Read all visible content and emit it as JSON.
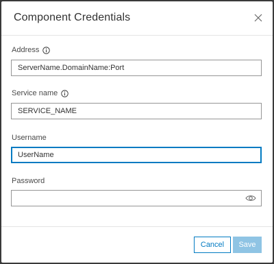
{
  "dialog": {
    "title": "Component Credentials"
  },
  "fields": {
    "address": {
      "label": "Address",
      "value": "ServerName.DomainName:Port"
    },
    "service_name": {
      "label": "Service name",
      "value": "SERVICE_NAME"
    },
    "username": {
      "label": "Username",
      "value": "UserName"
    },
    "password": {
      "label": "Password",
      "value": ""
    }
  },
  "footer": {
    "cancel_label": "Cancel",
    "save_label": "Save"
  },
  "icons": {
    "close": "close-icon",
    "info": "info-icon",
    "eye": "eye-icon"
  },
  "colors": {
    "accent": "#007ac2",
    "save_disabled": "#8fc4e4",
    "border": "#959595"
  }
}
